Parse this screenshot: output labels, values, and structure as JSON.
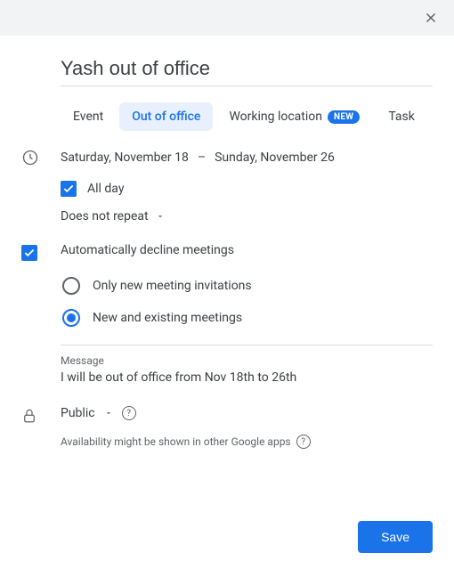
{
  "title": "Yash out of office",
  "tabs": {
    "event": "Event",
    "ooo": "Out of office",
    "working_location": "Working location",
    "working_location_badge": "NEW",
    "task": "Task"
  },
  "dates": {
    "start": "Saturday, November 18",
    "separator": "–",
    "end": "Sunday, November 26"
  },
  "all_day_label": "All day",
  "repeat_label": "Does not repeat",
  "auto_decline_label": "Automatically decline meetings",
  "radio": {
    "only_new": "Only new meeting invitations",
    "new_existing": "New and existing meetings"
  },
  "message": {
    "label": "Message",
    "text": "I will be out of office from Nov 18th to 26th"
  },
  "visibility_label": "Public",
  "hint_text": "Availability might be shown in other Google apps",
  "save_label": "Save"
}
